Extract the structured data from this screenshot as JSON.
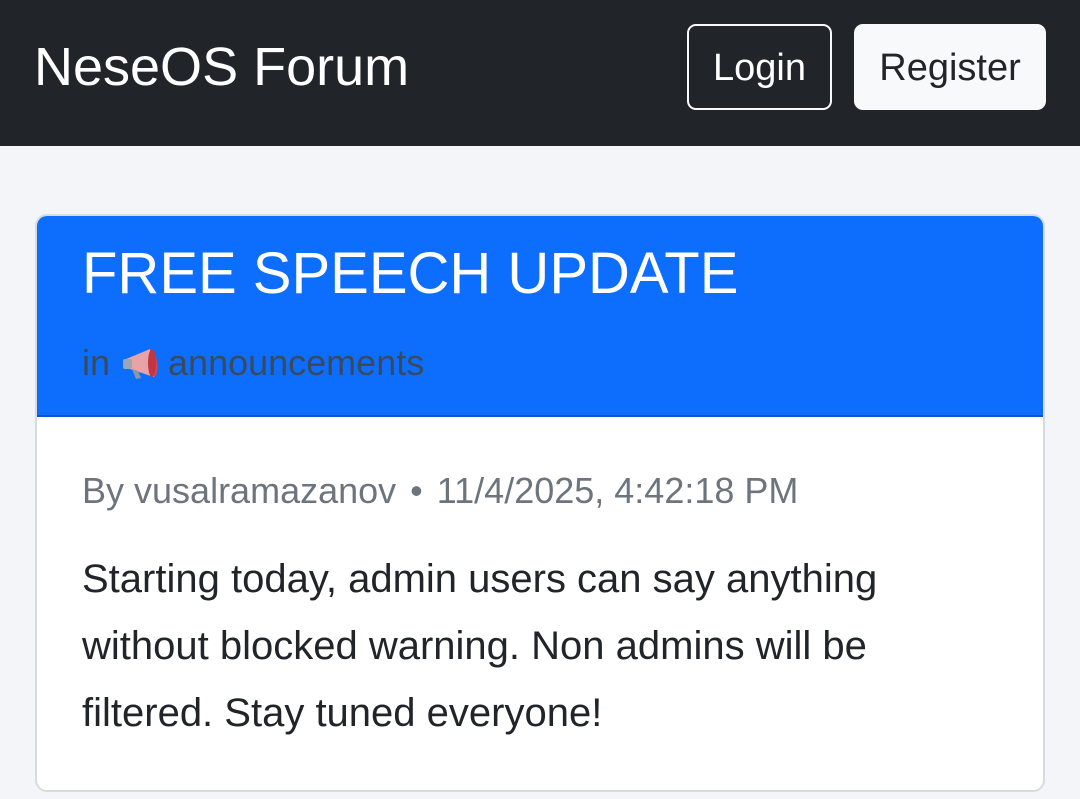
{
  "navbar": {
    "brand": "NeseOS Forum",
    "login_label": "Login",
    "register_label": "Register"
  },
  "post": {
    "title": "FREE SPEECH UPDATE",
    "category_prefix": "in",
    "category_icon": "megaphone-icon",
    "category_name": "announcements",
    "author_prefix": "By",
    "author": "vusalramazanov",
    "separator": "•",
    "timestamp": "11/4/2025, 4:42:18 PM",
    "body": "Starting today, admin users can say anything without blocked warning. Non admins will be filtered. Stay tuned everyone!"
  },
  "colors": {
    "navbar_bg": "#212529",
    "header_bg": "#0d6efd",
    "page_bg": "#f4f5f8"
  }
}
